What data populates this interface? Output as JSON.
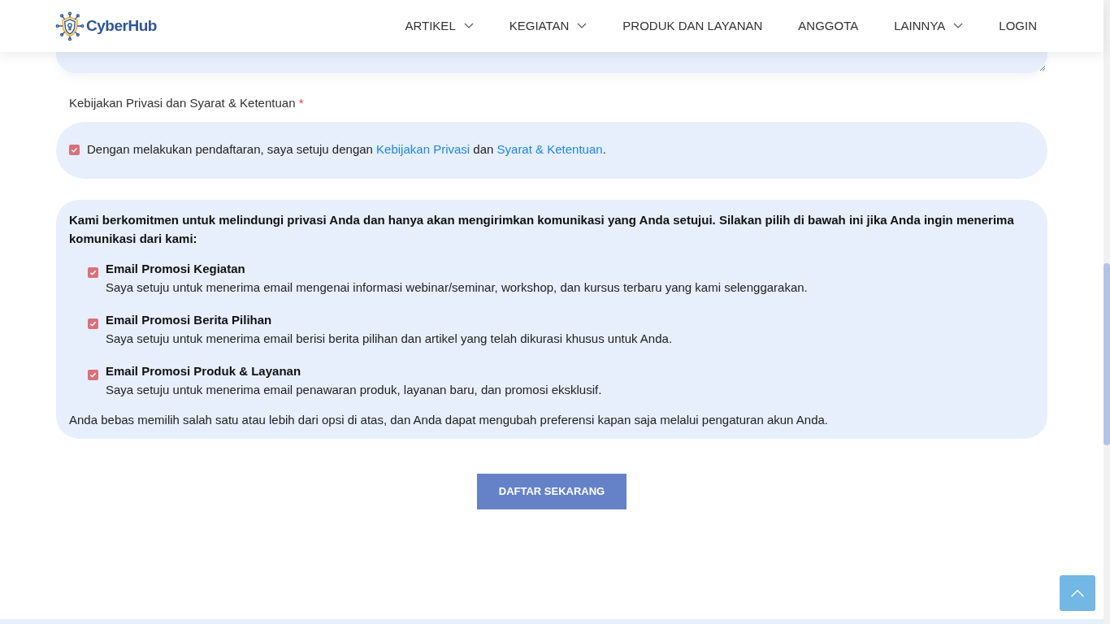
{
  "header": {
    "logo_text": "CyberHub",
    "nav": [
      {
        "label": "ARTIKEL",
        "dropdown": true
      },
      {
        "label": "KEGIATAN",
        "dropdown": true
      },
      {
        "label": "PRODUK DAN LAYANAN",
        "dropdown": false
      },
      {
        "label": "ANGGOTA",
        "dropdown": false
      },
      {
        "label": "LAINNYA",
        "dropdown": true
      },
      {
        "label": "LOGIN",
        "dropdown": false
      }
    ]
  },
  "privacy": {
    "label": "Kebijakan Privasi dan Syarat & Ketentuan",
    "required_mark": "*",
    "agree": {
      "checked": true,
      "parts": [
        {
          "kind": "text",
          "text": "Dengan melakukan pendaftaran, saya setuju dengan"
        },
        {
          "kind": "link",
          "text": "Kebijakan Privasi"
        },
        {
          "kind": "text",
          "text": "dan"
        },
        {
          "kind": "link",
          "text": "Syarat & Ketentuan"
        },
        {
          "kind": "text",
          "text": "."
        }
      ]
    }
  },
  "communications": {
    "intro": "Kami berkomitmen untuk melindungi privasi Anda dan hanya akan mengirimkan komunikasi yang Anda setujui. Silakan pilih di bawah ini jika Anda ingin menerima komunikasi dari kami:",
    "options": [
      {
        "title": "Email Promosi Kegiatan",
        "description": "Saya setuju untuk menerima email mengenai informasi webinar/seminar, workshop, dan kursus terbaru yang kami selenggarakan.",
        "checked": true
      },
      {
        "title": "Email Promosi Berita Pilihan",
        "description": "Saya setuju untuk menerima email berisi berita pilihan dan artikel yang telah dikurasi khusus untuk Anda.",
        "checked": true
      },
      {
        "title": "Email Promosi Produk & Layanan",
        "description": "Saya setuju untuk menerima email penawaran produk, layanan baru, dan promosi eksklusif.",
        "checked": true
      }
    ],
    "note": "Anda bebas memilih salah satu atau lebih dari opsi di atas, dan Anda dapat mengubah preferensi kapan saja melalui pengaturan akun Anda."
  },
  "submit": "DAFTAR SEKARANG"
}
